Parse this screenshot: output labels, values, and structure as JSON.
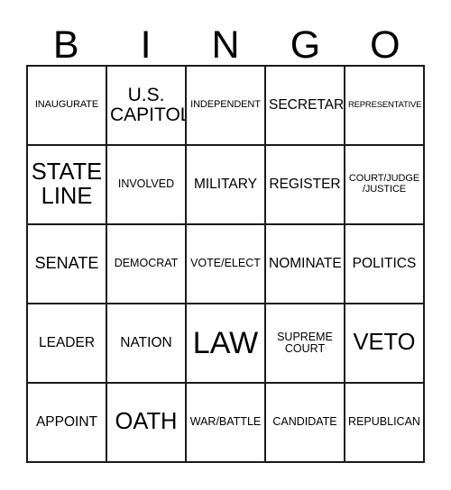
{
  "card": {
    "header_letters": [
      "B",
      "I",
      "N",
      "G",
      "O"
    ],
    "rows": [
      [
        {
          "text": "INAUGURATE",
          "size": "fs-xs"
        },
        {
          "text": "U.S.\nCAPITOL",
          "size": "fs-xl"
        },
        {
          "text": "INDEPENDENT",
          "size": "fs-xs"
        },
        {
          "text": "SECRETARY",
          "size": "fs-m"
        },
        {
          "text": "REPRESENTATIVE",
          "size": "fs-xxs"
        }
      ],
      [
        {
          "text": "STATE\nLINE",
          "size": "fs-xxl"
        },
        {
          "text": "INVOLVED",
          "size": "fs-s"
        },
        {
          "text": "MILITARY",
          "size": "fs-m"
        },
        {
          "text": "REGISTER",
          "size": "fs-m"
        },
        {
          "text": "COURT/JUDGE\n/JUSTICE",
          "size": "fs-xs"
        }
      ],
      [
        {
          "text": "SENATE",
          "size": "fs-l"
        },
        {
          "text": "DEMOCRAT",
          "size": "fs-s"
        },
        {
          "text": "VOTE/ELECT",
          "size": "fs-s"
        },
        {
          "text": "NOMINATE",
          "size": "fs-m"
        },
        {
          "text": "POLITICS",
          "size": "fs-m"
        }
      ],
      [
        {
          "text": "LEADER",
          "size": "fs-m"
        },
        {
          "text": "NATION",
          "size": "fs-m"
        },
        {
          "text": "LAW",
          "size": "fs-huge"
        },
        {
          "text": "SUPREME\nCOURT",
          "size": "fs-s"
        },
        {
          "text": "VETO",
          "size": "fs-xxl"
        }
      ],
      [
        {
          "text": "APPOINT",
          "size": "fs-m"
        },
        {
          "text": "OATH",
          "size": "fs-xxl"
        },
        {
          "text": "WAR/BATTLE",
          "size": "fs-s"
        },
        {
          "text": "CANDIDATE",
          "size": "fs-s"
        },
        {
          "text": "REPUBLICAN",
          "size": "fs-s"
        }
      ]
    ],
    "colors": {
      "background": "#ffffff",
      "grid_line": "#1a1a1a",
      "text": "#000000"
    }
  }
}
